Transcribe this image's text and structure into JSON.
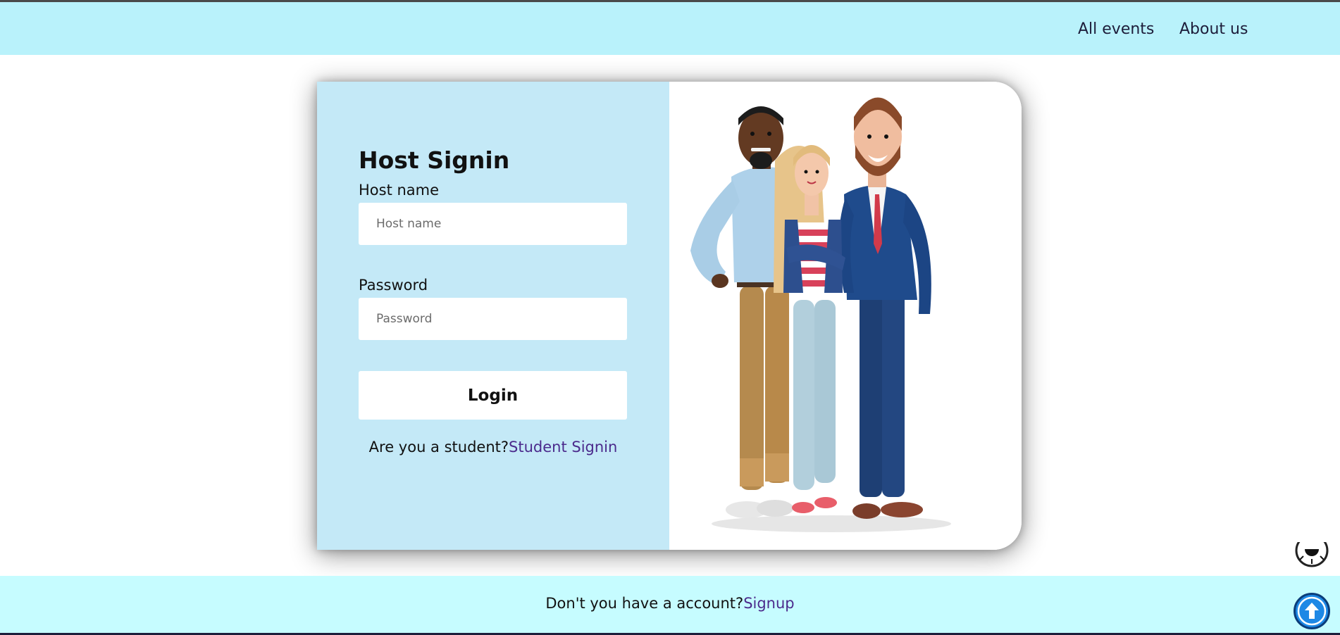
{
  "nav": {
    "links": [
      "All events",
      "About us"
    ]
  },
  "signin": {
    "title": "Host Signin",
    "host_label": "Host name",
    "host_placeholder": "Host name",
    "host_value": "",
    "password_label": "Password",
    "password_placeholder": "Password",
    "password_value": "",
    "login_label": "Login",
    "student_prompt": "Are you a student?",
    "student_link": "Student Signin"
  },
  "illustration": {
    "icon": "three-cartoon-people-illustration"
  },
  "footer": {
    "prompt": "Don't you have a account?",
    "signup_link": "Signup"
  },
  "icons": {
    "scroll_top": "arrow-up-icon",
    "theme": "theme-toggle-icon"
  },
  "colors": {
    "navbar": "#b9f2fb",
    "form_panel": "#c4e9f7",
    "footer": "#c6fcff",
    "link": "#4b2a8c",
    "scroll_button": "#1e88e5"
  }
}
